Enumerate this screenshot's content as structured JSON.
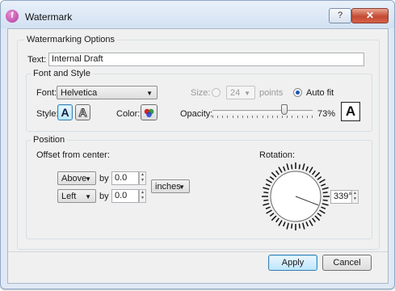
{
  "window": {
    "title": "Watermark",
    "help_glyph": "?",
    "close_glyph": "✕",
    "app_glyph": "f"
  },
  "options_group": {
    "label": "Watermarking Options",
    "text_label": "Text:",
    "text_value": "Internal Draft"
  },
  "font_group": {
    "label": "Font and Style",
    "font_label": "Font:",
    "font_value": "Helvetica",
    "size_label": "Size:",
    "size_value": "24",
    "points_label": "points",
    "autofit_label": "Auto fit",
    "autofit_selected": true,
    "style_label": "Style:",
    "style_solid_glyph": "A",
    "style_outline_glyph": "A",
    "color_label": "Color:",
    "opacity_label": "Opacity:",
    "opacity_value": "73%",
    "opacity_fraction": 0.73,
    "preview_glyph": "A"
  },
  "position_group": {
    "label": "Position",
    "offset_label": "Offset from center:",
    "vertical_dir": "Above",
    "vertical_by": "by",
    "vertical_value": "0.0",
    "horizontal_dir": "Left",
    "horizontal_by": "by",
    "horizontal_value": "0.0",
    "unit": "inches",
    "rotation_label": "Rotation:",
    "rotation_value": "339°",
    "rotation_degrees": 339
  },
  "buttons": {
    "apply": "Apply",
    "cancel": "Cancel"
  },
  "colors": {
    "accent": "#1b57b0",
    "dialog_bg": "#f0f0f0",
    "close_red": "#c44a33"
  }
}
